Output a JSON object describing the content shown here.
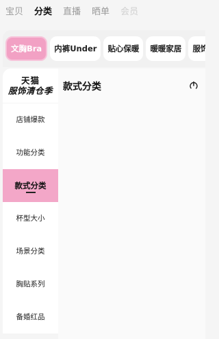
{
  "top_tabs": [
    {
      "label": "宝贝",
      "state": "normal"
    },
    {
      "label": "分类",
      "state": "active"
    },
    {
      "label": "直播",
      "state": "normal"
    },
    {
      "label": "晒单",
      "state": "normal"
    },
    {
      "label": "会员",
      "state": "fade"
    }
  ],
  "chips": [
    {
      "label": "文胸Bra",
      "active": true
    },
    {
      "label": "内裤Under",
      "active": false
    },
    {
      "label": "贴心保暖",
      "active": false
    },
    {
      "label": "暖暖家居",
      "active": false
    },
    {
      "label": "服饰配",
      "active": false
    }
  ],
  "brand": {
    "line1": "天猫",
    "line2": "服饰清仓季"
  },
  "sidebar": {
    "items": [
      {
        "label": "店铺爆款",
        "active": false
      },
      {
        "label": "功能分类",
        "active": false
      },
      {
        "label": "款式分类",
        "active": true
      },
      {
        "label": "杯型大小",
        "active": false
      },
      {
        "label": "场景分类",
        "active": false
      },
      {
        "label": "胸贴系列",
        "active": false
      },
      {
        "label": "备婚红品",
        "active": false
      }
    ]
  },
  "main": {
    "title": "款式分类",
    "icon": "power-icon"
  },
  "colors": {
    "accent": "#f2a1c4",
    "chip_active_border": "#f7c4da"
  }
}
